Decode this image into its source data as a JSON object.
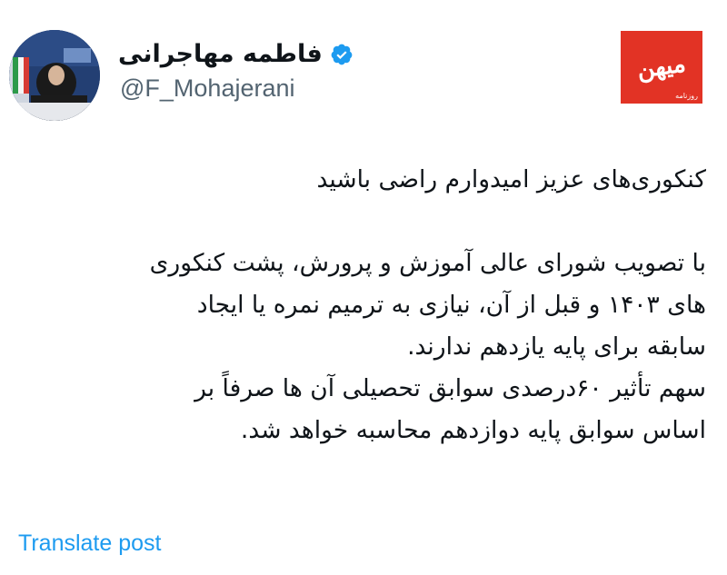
{
  "author": {
    "display_name": "فاطمه مهاجرانی",
    "handle": "@F_Mohajerani",
    "verified_icon": "verified-badge-icon",
    "verified_color": "#1d9bf0"
  },
  "source_logo": {
    "text": "میهن",
    "small_text": "روزنامه",
    "color": "#e23325"
  },
  "tweet": {
    "lines": [
      "کنکوری‌های عزیز امیدوارم راضی باشید",
      "",
      "با تصویب شورای عالی آموزش و پرورش، پشت کنکوری",
      "های ۱۴۰۳ و قبل از آن، نیازی به ترمیم نمره یا ایجاد",
      "سابقه برای پایه یازدهم ندارند.",
      "سهم تأثیر ۶۰درصدی سوابق تحصیلی آن ها صرفاً بر",
      "اساس سوابق پایه دوازدهم محاسبه خواهد شد."
    ]
  },
  "translate_label": "Translate post",
  "colors": {
    "text": "#0f1419",
    "secondary": "#536471",
    "link": "#1d9bf0"
  }
}
